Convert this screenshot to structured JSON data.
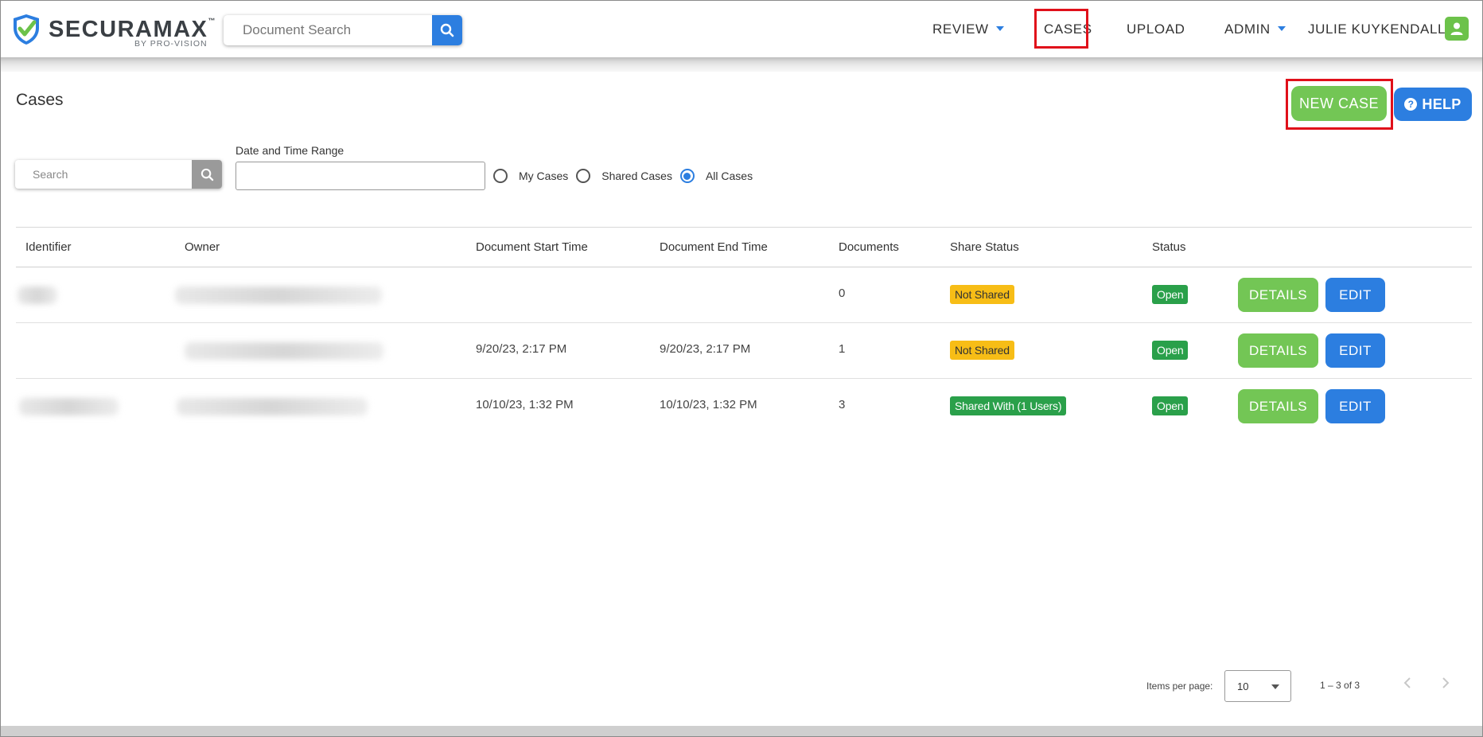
{
  "header": {
    "logo_text": "SECURAMAX",
    "logo_tm": "™",
    "logo_sub": "BY PRO-VISION",
    "search_placeholder": "Document Search",
    "nav": {
      "review": "REVIEW",
      "cases": "CASES",
      "upload": "UPLOAD",
      "admin": "ADMIN",
      "user": "JULIE KUYKENDALL"
    }
  },
  "page": {
    "title": "Cases",
    "new_case_label": "NEW CASE",
    "help_label": "HELP"
  },
  "filters": {
    "search_placeholder": "Search",
    "date_range_label": "Date and Time Range",
    "date_range_value": "",
    "radios": [
      {
        "label": "My Cases",
        "checked": false
      },
      {
        "label": "Shared Cases",
        "checked": false
      },
      {
        "label": "All Cases",
        "checked": true
      }
    ]
  },
  "table": {
    "columns": [
      "Identifier",
      "Owner",
      "Document Start Time",
      "Document End Time",
      "Documents",
      "Share Status",
      "Status"
    ],
    "rows": [
      {
        "start": "",
        "end": "",
        "documents": "0",
        "share_status": "Not Shared",
        "status": "Open"
      },
      {
        "start": "9/20/23, 2:17 PM",
        "end": "9/20/23, 2:17 PM",
        "documents": "1",
        "share_status": "Not Shared",
        "status": "Open"
      },
      {
        "start": "10/10/23, 1:32 PM",
        "end": "10/10/23, 1:32 PM",
        "documents": "3",
        "share_status": "Shared With (1 Users)",
        "status": "Open"
      }
    ],
    "details_label": "DETAILS",
    "edit_label": "EDIT"
  },
  "paginator": {
    "items_per_page_label": "Items per page:",
    "items_per_page_value": "10",
    "range_label": "1 – 3 of 3",
    "prev_icon": "chevron-left-icon",
    "next_icon": "chevron-right-icon"
  },
  "colors": {
    "primary_blue": "#2c7ee0",
    "green": "#73c655",
    "highlight_red": "#e0101a",
    "badge_yellow": "#f7bd16",
    "badge_green": "#2aa04a"
  }
}
